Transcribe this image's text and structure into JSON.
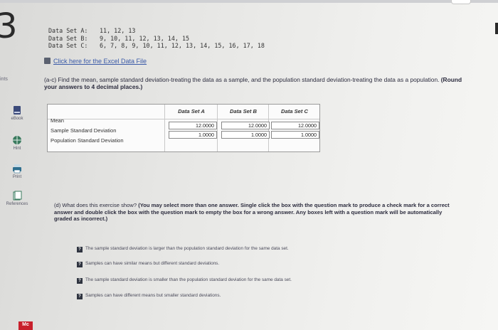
{
  "question_number": "3",
  "points_label": "ints",
  "data_sets": [
    {
      "name": "Data Set A:",
      "values": "11, 12, 13"
    },
    {
      "name": "Data Set B:",
      "values": "9, 10, 11, 12, 13, 14, 15"
    },
    {
      "name": "Data Set C:",
      "values": "6, 7, 8, 9, 10, 11, 12, 13, 14, 15, 16, 17, 18"
    }
  ],
  "excel_link": "Click here for the Excel Data File",
  "question_ac": {
    "text": "(a-c) Find the mean, sample standard deviation-treating the data as a sample, and the population standard deviation-treating the data as a population.",
    "bold": "(Round your answers to 4 decimal places.)"
  },
  "table": {
    "headers": [
      "Data Set A",
      "Data Set B",
      "Data Set C"
    ],
    "rows": [
      {
        "label": "Mean",
        "values": [
          "12.0000",
          "12.0000",
          "12.0000"
        ]
      },
      {
        "label": "Sample Standard Deviation",
        "values": [
          "1.0000",
          "1.0000",
          "1.0000"
        ]
      },
      {
        "label": "Population Standard Deviation",
        "values": [
          "",
          "",
          ""
        ]
      }
    ]
  },
  "question_d": {
    "text": "(d) What does this exercise show?",
    "bold": "(You may select more than one answer. Single click the box with the question mark to produce a check mark for a correct answer and double click the box with the question mark to empty the box for a wrong answer. Any boxes left with a question mark will be automatically graded as incorrect.)"
  },
  "choices": [
    "The sample standard deviation is larger than the population standard deviation for the same data set.",
    "Samples can have similar means but different standard deviations.",
    "The sample standard deviation is smaller than the population standard deviation for the same data set.",
    "Samples can have different means but smaller standard deviations."
  ],
  "sidebar": {
    "ebook": "eBook",
    "hint": "Hint",
    "print": "Print",
    "references": "References"
  },
  "logo_text": "Mc",
  "qmark_symbol": "?"
}
